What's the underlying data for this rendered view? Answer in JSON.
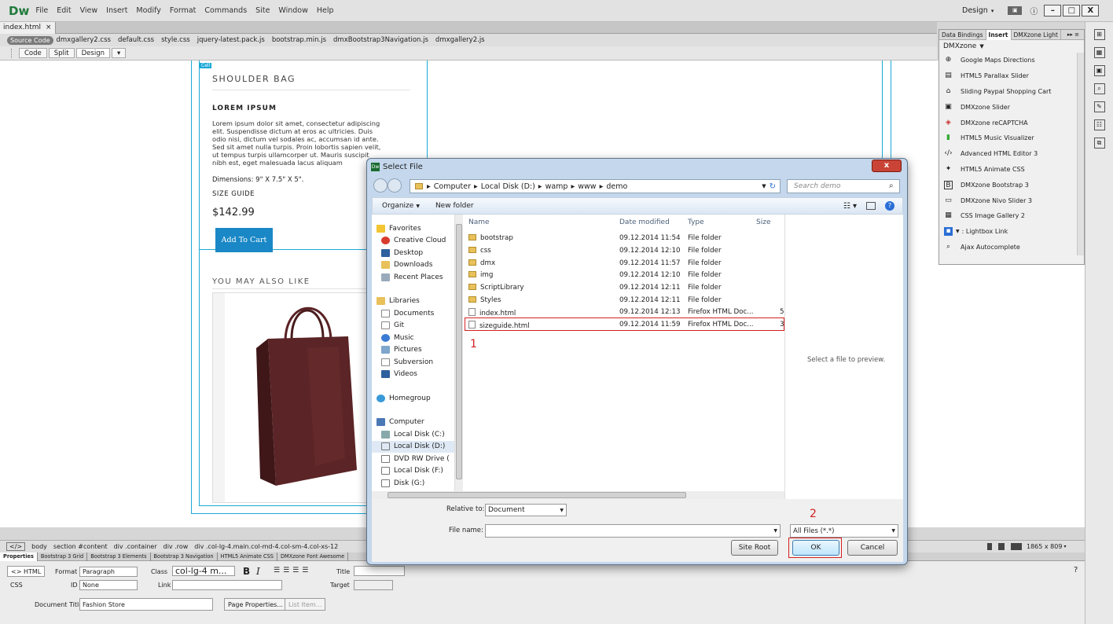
{
  "app": {
    "logo": "Dw",
    "menu": [
      "File",
      "Edit",
      "View",
      "Insert",
      "Modify",
      "Format",
      "Commands",
      "Site",
      "Window",
      "Help"
    ],
    "workspace": "Design",
    "win_min": "–",
    "win_max": "□",
    "win_close": "X"
  },
  "doc": {
    "tab": "index.html",
    "tab_close": "×",
    "source_code": "Source Code",
    "related": [
      "dmxgallery2.css",
      "default.css",
      "style.css",
      "jquery-latest.pack.js",
      "bootstrap.min.js",
      "dmxBootstrap3Navigation.js",
      "dmxgallery2.js"
    ],
    "views": [
      "Code",
      "Split",
      "Design"
    ]
  },
  "page": {
    "cell_label": "Cell",
    "product_title": "SHOULDER BAG",
    "lorem_heading": "LOREM IPSUM",
    "lorem_lines": [
      "Lorem ipsum dolor sit amet, consectetur adipiscing",
      "elit. Suspendisse dictum at eros ac ultricies. Duis",
      "odio nisi, dictum vel sodales ac, accumsan id ante.",
      "Sed sit amet nulla turpis. Proin lobortis sapien velit,",
      "ut tempus turpis ullamcorper ut. Mauris suscipit",
      "nibh est, eget malesuada lacus aliquam"
    ],
    "dimensions": "Dimensions: 9\" X 7.5\" X 5\".",
    "size_guide": "SIZE GUIDE",
    "price": "$142.99",
    "add_to_cart": "Add To Cart",
    "also_like": "YOU MAY ALSO LIKE"
  },
  "insert_panel": {
    "tabs": [
      "Data Bindings",
      "Insert",
      "DMXzone Light"
    ],
    "category": "DMXzone",
    "items": [
      "Google Maps Directions",
      "HTML5 Parallax Slider",
      "Sliding Paypal Shopping Cart",
      "DMXzone Slider",
      "DMXzone reCAPTCHA",
      "HTML5 Music Visualizer",
      "Advanced HTML Editor 3",
      "HTML5 Animate CSS",
      "DMXzone Bootstrap 3",
      "DMXzone Nivo Slider 3",
      "CSS Image Gallery 2",
      ": Lightbox Link",
      "Ajax Autocomplete"
    ]
  },
  "statusbar": {
    "tags": [
      "</>",
      "body",
      "section #content",
      "div .container",
      "div .row",
      "div .col-lg-4.main.col-md-4.col-sm-4.col-xs-12"
    ],
    "size": "1865 x 809"
  },
  "props": {
    "tabs": [
      "Properties",
      "Bootstrap 3 Grid",
      "Bootstrap 3 Elements",
      "Bootstrap 3 Navigation",
      "HTML5 Animate CSS",
      "DMXzone Font Awesome"
    ],
    "html_btn": "<> HTML",
    "css_btn": "CSS",
    "format_label": "Format",
    "format_value": "Paragraph",
    "class_label": "Class",
    "class_value": "col-lg-4 m...",
    "id_label": "ID",
    "id_value": "None",
    "link_label": "Link",
    "title_label": "Title",
    "target_label": "Target",
    "bold": "B",
    "italic": "I",
    "doc_title_label": "Document Title",
    "doc_title_value": "Fashion Store",
    "page_props": "Page Properties...",
    "list_item": "List Item..."
  },
  "dialog": {
    "title": "Select File",
    "close": "x",
    "path": [
      "Computer",
      "Local Disk (D:)",
      "wamp",
      "www",
      "demo"
    ],
    "search_placeholder": "Search demo",
    "organize": "Organize",
    "new_folder": "New folder",
    "nav": {
      "favorites": "Favorites",
      "fav_items": [
        "Creative Cloud",
        "Desktop",
        "Downloads",
        "Recent Places"
      ],
      "libraries": "Libraries",
      "lib_items": [
        "Documents",
        "Git",
        "Music",
        "Pictures",
        "Subversion",
        "Videos"
      ],
      "homegroup": "Homegroup",
      "computer": "Computer",
      "drives": [
        "Local Disk (C:)",
        "Local Disk (D:)",
        "DVD RW Drive (",
        "Local Disk (F:)",
        "Disk (G:)"
      ]
    },
    "columns": [
      "Name",
      "Date modified",
      "Type",
      "Size"
    ],
    "files": [
      {
        "name": "bootstrap",
        "date": "09.12.2014 11:54",
        "type": "File folder",
        "size": "",
        "folder": true
      },
      {
        "name": "css",
        "date": "09.12.2014 12:10",
        "type": "File folder",
        "size": "",
        "folder": true
      },
      {
        "name": "dmx",
        "date": "09.12.2014 11:57",
        "type": "File folder",
        "size": "",
        "folder": true
      },
      {
        "name": "img",
        "date": "09.12.2014 12:10",
        "type": "File folder",
        "size": "",
        "folder": true
      },
      {
        "name": "ScriptLibrary",
        "date": "09.12.2014 12:11",
        "type": "File folder",
        "size": "",
        "folder": true
      },
      {
        "name": "Styles",
        "date": "09.12.2014 12:11",
        "type": "File folder",
        "size": "",
        "folder": true
      },
      {
        "name": "index.html",
        "date": "09.12.2014 12:13",
        "type": "Firefox HTML Doc...",
        "size": "5",
        "folder": false
      },
      {
        "name": "sizeguide.html",
        "date": "09.12.2014 11:59",
        "type": "Firefox HTML Doc...",
        "size": "3",
        "folder": false
      }
    ],
    "preview_text": "Select a file to preview.",
    "relative_label": "Relative to:",
    "relative_value": "Document",
    "filename_label": "File name:",
    "filename_value": "",
    "filetype": "All Files (*.*)",
    "site_root": "Site Root",
    "ok": "OK",
    "cancel": "Cancel",
    "annotation_1": "1",
    "annotation_2": "2"
  }
}
